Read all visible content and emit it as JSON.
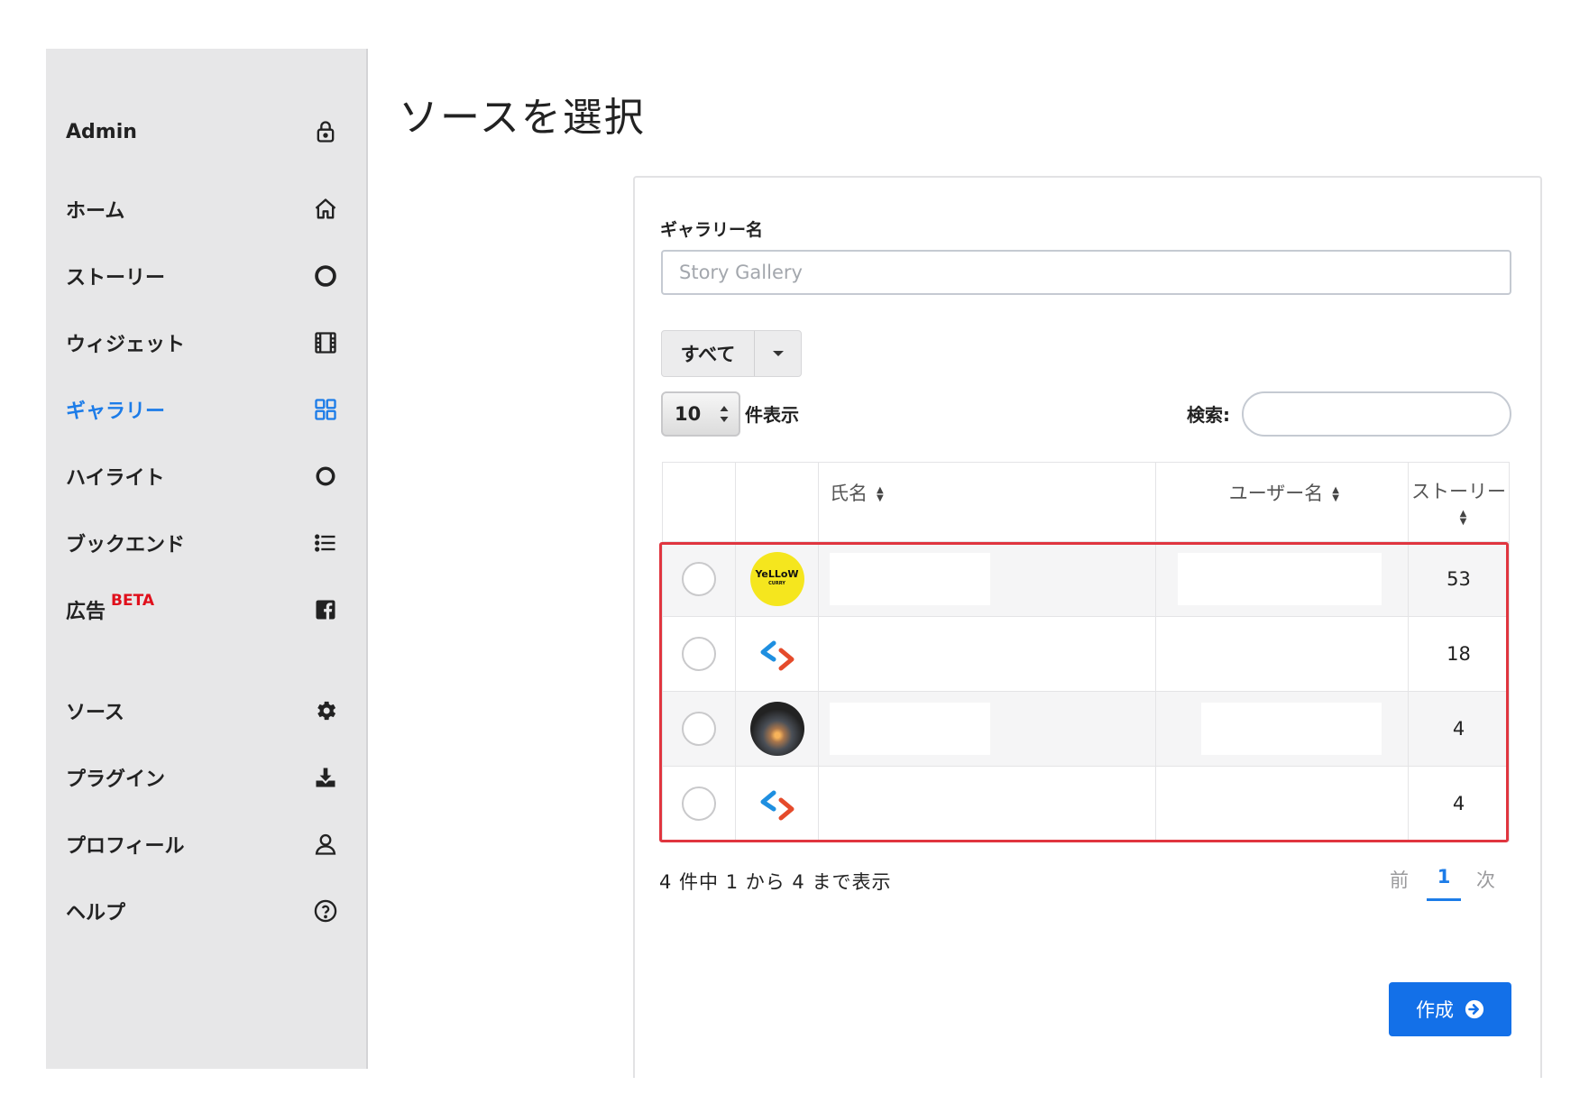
{
  "sidebar": {
    "header": "Admin",
    "items": [
      {
        "label": "ホーム",
        "icon": "home-icon"
      },
      {
        "label": "ストーリー",
        "icon": "ring-icon"
      },
      {
        "label": "ウィジェット",
        "icon": "film-icon"
      },
      {
        "label": "ギャラリー",
        "icon": "grid-icon",
        "active": true
      },
      {
        "label": "ハイライト",
        "icon": "circle-icon"
      },
      {
        "label": "ブックエンド",
        "icon": "list-icon"
      },
      {
        "label": "広告",
        "badge": "BETA",
        "icon": "facebook-icon"
      },
      {
        "label": "ソース",
        "icon": "gear-icon"
      },
      {
        "label": "プラグイン",
        "icon": "download-icon"
      },
      {
        "label": "プロフィール",
        "icon": "user-icon"
      },
      {
        "label": "ヘルプ",
        "icon": "help-icon"
      }
    ]
  },
  "page": {
    "title": "ソースを選択"
  },
  "form": {
    "gallery_label": "ギャラリー名",
    "gallery_placeholder": "Story Gallery",
    "filter_label": "すべて",
    "length_value": "10",
    "length_label": "件表示",
    "search_label": "検索:"
  },
  "table": {
    "headers": {
      "name": "氏名",
      "username": "ユーザー名",
      "stories": "ストーリー"
    },
    "rows": [
      {
        "avatar": "yellow",
        "avatar_text": "YeLLoW",
        "avatar_sub": "CURRY",
        "stories": "53"
      },
      {
        "avatar": "code",
        "stories": "18"
      },
      {
        "avatar": "sunset",
        "stories": "4"
      },
      {
        "avatar": "code",
        "stories": "4"
      }
    ]
  },
  "footer": {
    "info": "4 件中 1 から 4 まで表示",
    "prev": "前",
    "page": "1",
    "next": "次",
    "create": "作成"
  },
  "colors": {
    "accent": "#1c7ce8",
    "highlight": "#e0353f",
    "beta": "#e0101c",
    "button": "#1370e8"
  }
}
